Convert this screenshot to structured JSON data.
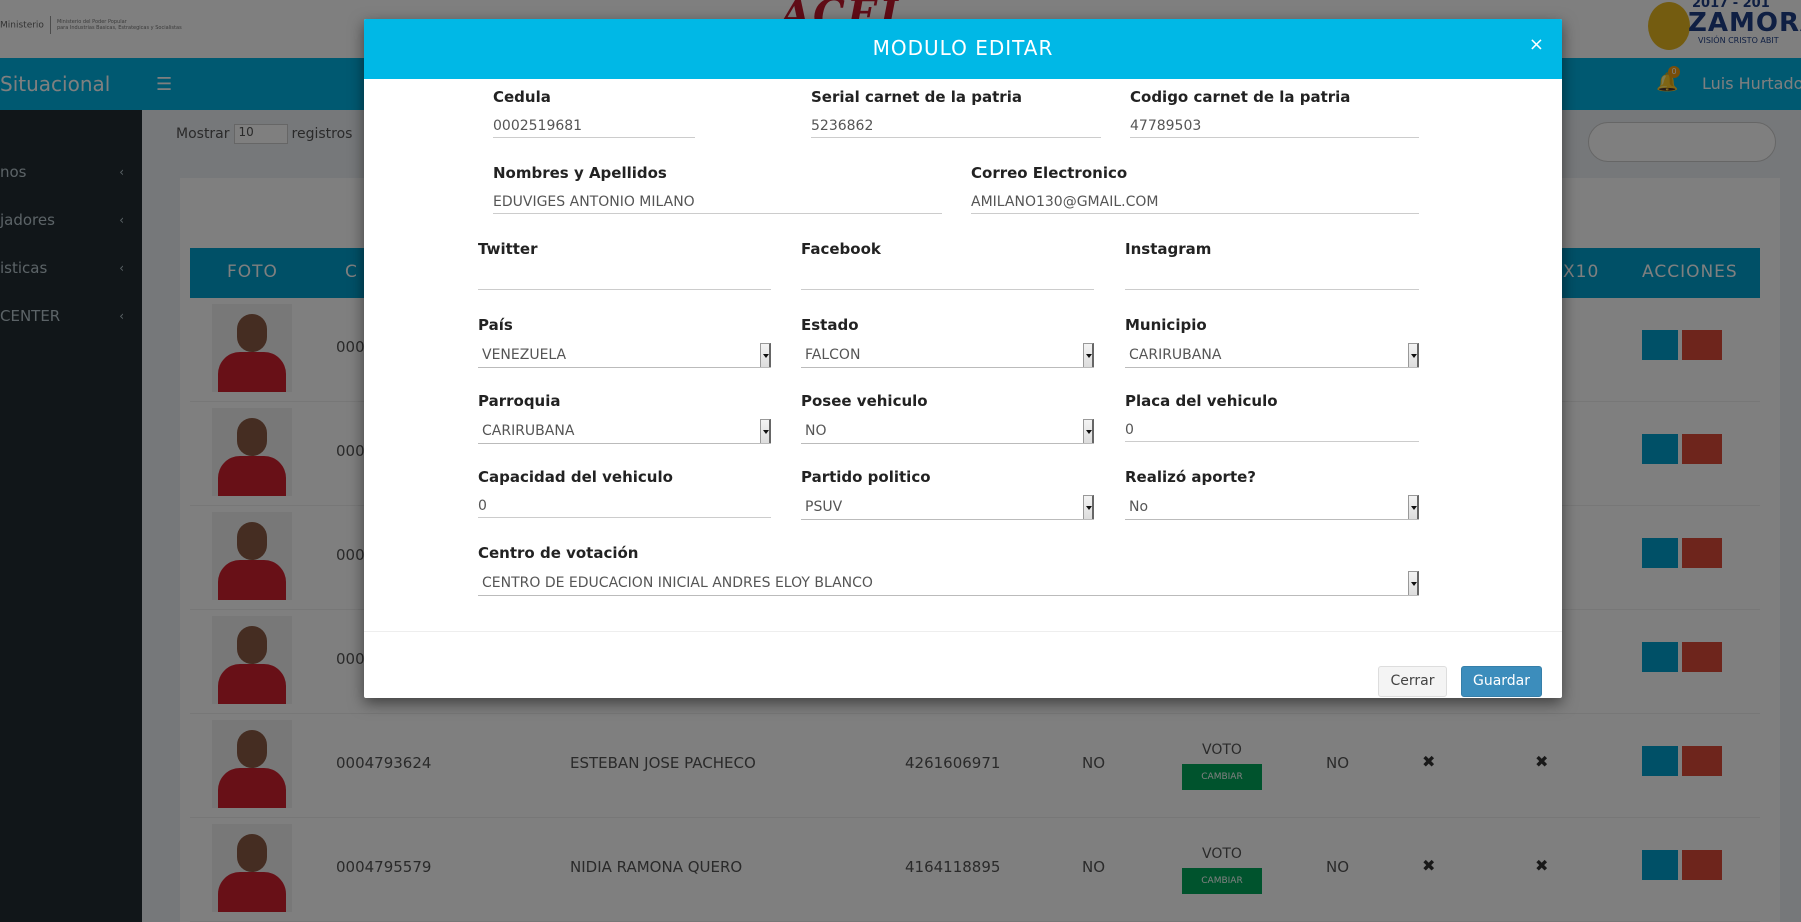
{
  "background": {
    "gov_logo": {
      "main": "Ministerio",
      "line1": "Ministerio del Poder Popular",
      "line2": "para Industrias Basicas, Estrategicas y Socialistas"
    },
    "center_logo": "ACEL",
    "right_logo": {
      "year": "2017 - 201",
      "word": "ZAMORA",
      "tag": "VISIÓN CRISTO ABIT"
    },
    "navbar": {
      "brand": "Situacional",
      "user": "Luis Hurtado",
      "notification_count": "0"
    },
    "sidebar": [
      {
        "label": "nos"
      },
      {
        "label": "jadores"
      },
      {
        "label": "isticas"
      },
      {
        "label": "CENTER"
      }
    ],
    "show_label": "Mostrar",
    "show_value": "10",
    "show_suffix": "registros",
    "table_headers": {
      "foto": "FOTO",
      "c": "C",
      "x10": "X10",
      "acciones": "ACCIONES"
    },
    "rows": [
      {
        "cedula": "000",
        "nombre": "",
        "telefono": "",
        "carnet": "",
        "voto": "",
        "aporte": ""
      },
      {
        "cedula": "000",
        "nombre": "",
        "telefono": "",
        "carnet": "",
        "voto": "",
        "aporte": ""
      },
      {
        "cedula": "000",
        "nombre": "",
        "telefono": "",
        "carnet": "",
        "voto": "",
        "aporte": ""
      },
      {
        "cedula": "000",
        "nombre": "",
        "telefono": "",
        "carnet": "",
        "voto": "",
        "aporte": ""
      },
      {
        "cedula": "0004793624",
        "nombre": "ESTEBAN JOSE PACHECO",
        "telefono": "4261606971",
        "carnet": "NO",
        "voto": "VOTO",
        "aporte": "NO"
      },
      {
        "cedula": "0004795579",
        "nombre": "NIDIA RAMONA QUERO",
        "telefono": "4164118895",
        "carnet": "NO",
        "voto": "VOTO",
        "aporte": "NO"
      }
    ],
    "cambiar_label": "CAMBIAR"
  },
  "modal": {
    "title": "MODULO EDITAR",
    "close_symbol": "×",
    "fields": {
      "cedula": {
        "label": "Cedula",
        "value": "0002519681"
      },
      "serial_carnet": {
        "label": "Serial carnet de la patria",
        "value": "5236862"
      },
      "codigo_carnet": {
        "label": "Codigo carnet de la patria",
        "value": "47789503"
      },
      "nombres": {
        "label": "Nombres y Apellidos",
        "value": "EDUVIGES ANTONIO MILANO"
      },
      "correo": {
        "label": "Correo Electronico",
        "value": "AMILANO130@GMAIL.COM"
      },
      "twitter": {
        "label": "Twitter",
        "value": ""
      },
      "facebook": {
        "label": "Facebook",
        "value": ""
      },
      "instagram": {
        "label": "Instagram",
        "value": ""
      },
      "pais": {
        "label": "País",
        "value": "VENEZUELA"
      },
      "estado": {
        "label": "Estado",
        "value": "FALCON"
      },
      "municipio": {
        "label": "Municipio",
        "value": "CARIRUBANA"
      },
      "parroquia": {
        "label": "Parroquia",
        "value": "CARIRUBANA"
      },
      "posee_vehiculo": {
        "label": "Posee vehiculo",
        "value": "NO"
      },
      "placa": {
        "label": "Placa del vehiculo",
        "value": "0"
      },
      "capacidad": {
        "label": "Capacidad del vehiculo",
        "value": "0"
      },
      "partido": {
        "label": "Partido politico",
        "value": "PSUV"
      },
      "aporte": {
        "label": "Realizó aporte?",
        "value": "No"
      },
      "centro": {
        "label": "Centro de votación",
        "value": "CENTRO DE EDUCACION INICIAL ANDRES ELOY BLANCO"
      }
    },
    "buttons": {
      "cerrar": "Cerrar",
      "guardar": "Guardar"
    }
  },
  "colors": {
    "header": "#00b8e6",
    "guardar": "#3c8dbc",
    "navbar": "#00b3e3",
    "sidebar": "#222d32"
  }
}
